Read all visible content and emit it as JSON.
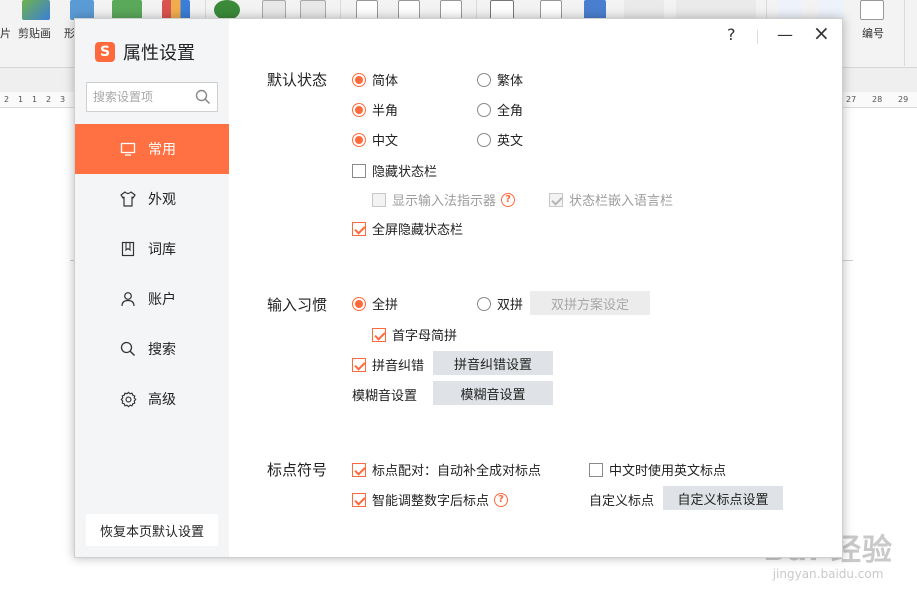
{
  "app": {
    "ribbon_labels": [
      "片",
      "剪贴画",
      "形",
      "编号"
    ],
    "ruler_ticks_left": [
      "2",
      "1",
      "1",
      "2",
      "3",
      "4",
      "5",
      "6"
    ],
    "ruler_ticks_right": [
      "27",
      "28",
      "29"
    ],
    "watermark": "Bai 经验",
    "watermark_sub": "jingyan.baidu.com"
  },
  "dialog": {
    "title": "属性设置",
    "logo_letter": "S",
    "help_label": "?",
    "minimize_label": "—",
    "close_label": "×",
    "search_placeholder": "搜索设置项",
    "nav": [
      {
        "label": "常用",
        "icon": "monitor-icon",
        "active": true
      },
      {
        "label": "外观",
        "icon": "shirt-icon",
        "active": false
      },
      {
        "label": "词库",
        "icon": "book-icon",
        "active": false
      },
      {
        "label": "账户",
        "icon": "user-icon",
        "active": false
      },
      {
        "label": "搜索",
        "icon": "search-icon",
        "active": false
      },
      {
        "label": "高级",
        "icon": "gear-icon",
        "active": false
      }
    ],
    "reset_label": "恢复本页默认设置"
  },
  "default_state": {
    "title": "默认状态",
    "simplified": "简体",
    "traditional": "繁体",
    "half_width": "半角",
    "full_width": "全角",
    "chinese": "中文",
    "english": "英文",
    "hide_status_bar": "隐藏状态栏",
    "show_indicator": "显示输入法指示器",
    "embed_language_bar": "状态栏嵌入语言栏",
    "fullscreen_hide_status_bar": "全屏隐藏状态栏"
  },
  "input_habits": {
    "title": "输入习惯",
    "full_pinyin": "全拼",
    "double_pinyin": "双拼",
    "double_pinyin_setup": "双拼方案设定",
    "initial_abbrev": "首字母简拼",
    "pinyin_correction": "拼音纠错",
    "pinyin_correction_setup": "拼音纠错设置",
    "fuzzy_label": "模糊音设置",
    "fuzzy_button": "模糊音设置"
  },
  "punctuation": {
    "title": "标点符号",
    "auto_pair": "标点配对：自动补全成对标点",
    "english_punct_in_chinese": "中文时使用英文标点",
    "smart_digit_punct": "智能调整数字后标点",
    "custom_label": "自定义标点",
    "custom_button": "自定义标点设置"
  },
  "colors": {
    "accent": "#ff6a3d",
    "sidebar_active": "#ff7043",
    "sidebar_bg": "#f4f5f7",
    "button_bg": "#dfe2e6"
  }
}
